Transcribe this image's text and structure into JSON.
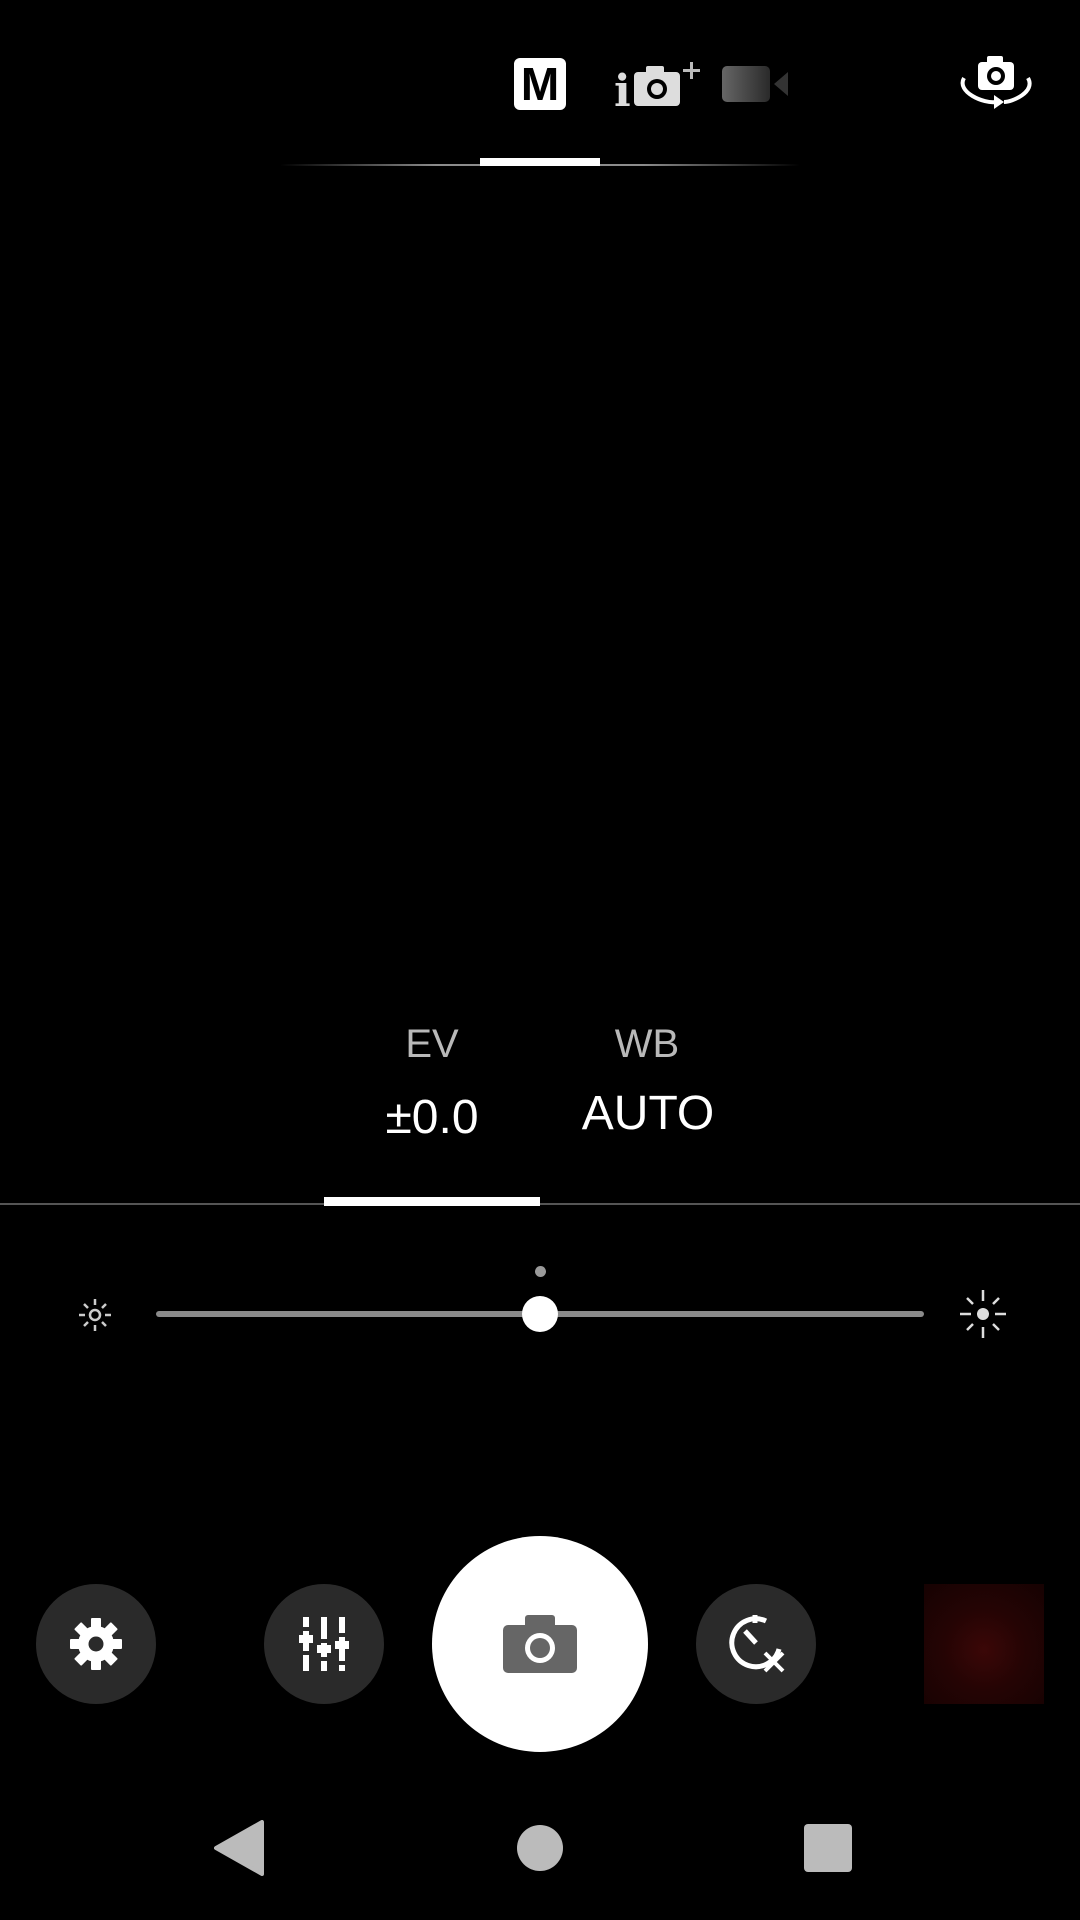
{
  "modes": {
    "items": [
      {
        "name": "manual",
        "label": "M",
        "selected": true
      },
      {
        "name": "superior-auto",
        "icon": "intelligent-auto-plus-icon"
      },
      {
        "name": "video",
        "icon": "video-camera-icon"
      }
    ],
    "switch_camera_icon": "camera-flip-icon"
  },
  "params": {
    "ev": {
      "label": "EV",
      "value": "±0.0",
      "selected": true
    },
    "wb": {
      "label": "WB",
      "value": "AUTO"
    }
  },
  "ev_slider": {
    "min_icon": "brightness-low-icon",
    "max_icon": "brightness-high-icon",
    "value": 0.0,
    "position_fraction": 0.5
  },
  "controls": {
    "settings_icon": "gear-icon",
    "adjust_icon": "sliders-icon",
    "shutter_icon": "camera-icon",
    "timer_icon": "timer-off-icon",
    "thumbnail": "last-photo-thumbnail"
  },
  "navbar": {
    "back_icon": "back-triangle-icon",
    "home_icon": "home-circle-icon",
    "recents_icon": "recents-square-icon"
  },
  "colors": {
    "background": "#000000",
    "button_bg": "#2a2a2a",
    "accent": "#ffffff",
    "label_gray": "#b9b9b9"
  }
}
